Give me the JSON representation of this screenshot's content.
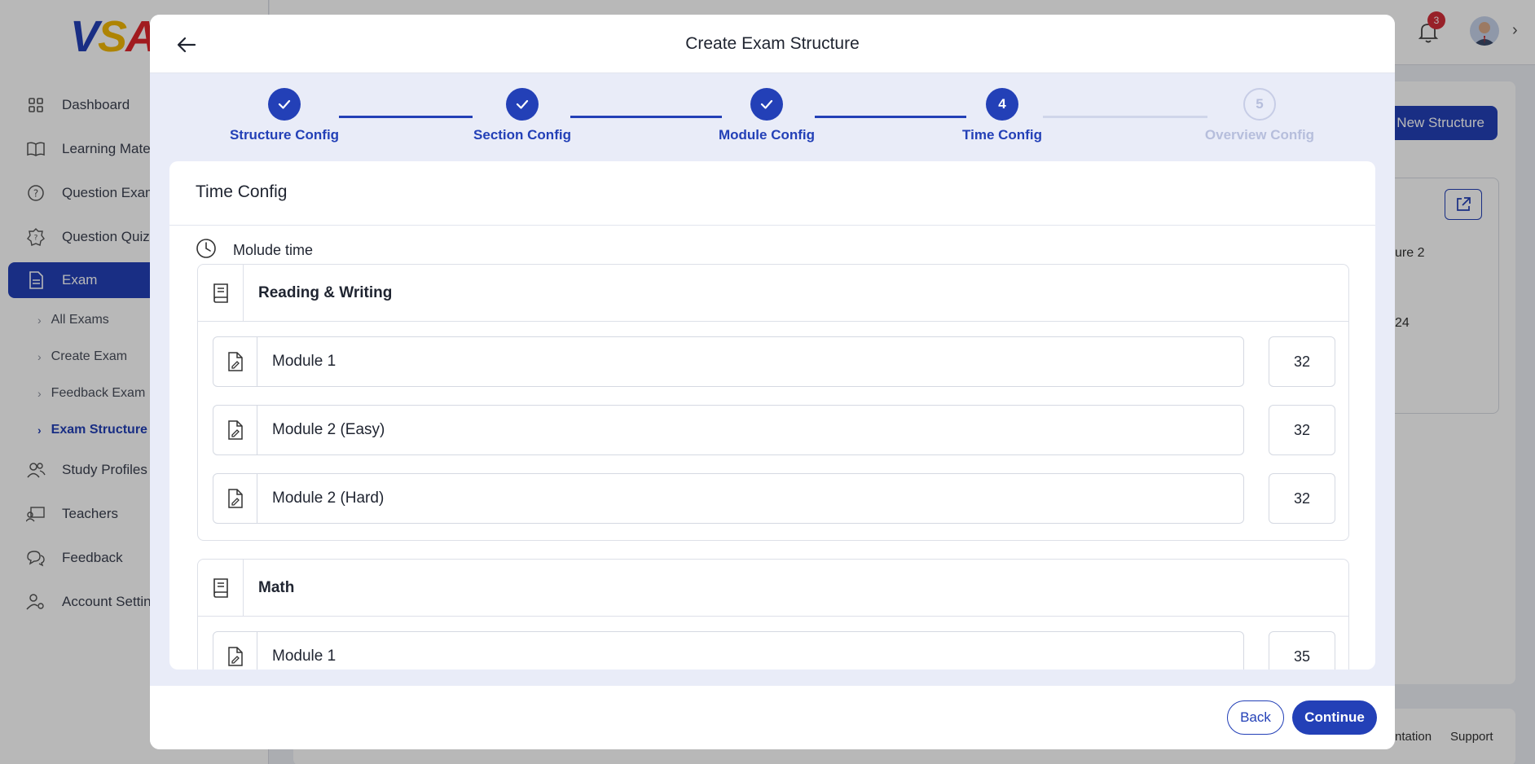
{
  "logo": {
    "text_parts": [
      "V",
      "S",
      "A"
    ]
  },
  "sidebar": {
    "items": [
      {
        "label": "Dashboard",
        "icon": "grid-icon"
      },
      {
        "label": "Learning Mater",
        "icon": "book-open-icon"
      },
      {
        "label": "Question Exam",
        "icon": "question-circle-icon"
      },
      {
        "label": "Question Quiz",
        "icon": "quiz-badge-icon"
      },
      {
        "label": "Exam",
        "icon": "document-icon",
        "active": true
      }
    ],
    "exam_sub_items": [
      {
        "label": "All Exams"
      },
      {
        "label": "Create Exam"
      },
      {
        "label": "Feedback Exam"
      },
      {
        "label": "Exam Structure",
        "active": true
      }
    ],
    "items_after": [
      {
        "label": "Study Profiles",
        "icon": "users-icon"
      },
      {
        "label": "Teachers",
        "icon": "teacher-icon"
      },
      {
        "label": "Feedback",
        "icon": "chat-icon"
      },
      {
        "label": "Account Setting",
        "icon": "user-gear-icon"
      }
    ]
  },
  "topbar": {
    "notification_count": "3"
  },
  "background": {
    "new_structure_label": "New Structure",
    "card_text_1": "ure 2",
    "card_text_2": "24",
    "footer_link_1": "ntation",
    "footer_link_2": "Support"
  },
  "modal": {
    "title": "Create Exam Structure",
    "steps": [
      {
        "number": "1",
        "label": "Structure Config",
        "status": "done"
      },
      {
        "number": "2",
        "label": "Section Config",
        "status": "done"
      },
      {
        "number": "3",
        "label": "Module Config",
        "status": "done"
      },
      {
        "number": "4",
        "label": "Time Config",
        "status": "current"
      },
      {
        "number": "5",
        "label": "Overview Config",
        "status": "pending"
      }
    ],
    "content_title": "Time Config",
    "time_label": "Molude time",
    "sections": [
      {
        "title": "Reading & Writing",
        "modules": [
          {
            "name": "Module 1",
            "time": "32"
          },
          {
            "name": "Module 2 (Easy)",
            "time": "32"
          },
          {
            "name": "Module 2 (Hard)",
            "time": "32"
          }
        ]
      },
      {
        "title": "Math",
        "modules": [
          {
            "name": "Module 1",
            "time": "35"
          }
        ]
      }
    ],
    "back_label": "Back",
    "continue_label": "Continue"
  },
  "colors": {
    "primary": "#2340b7",
    "pending_step": "#b6bedc",
    "badge": "#d32f3a"
  }
}
